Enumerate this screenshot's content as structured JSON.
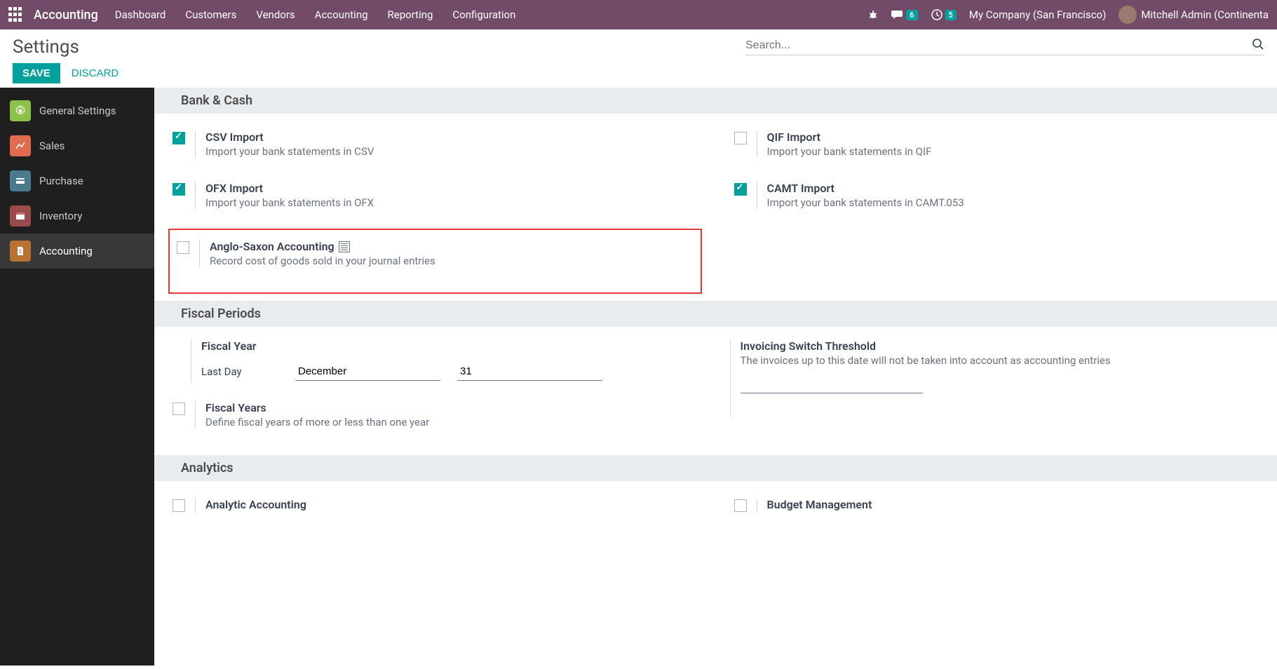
{
  "topnav": {
    "brand": "Accounting",
    "menu": [
      "Dashboard",
      "Customers",
      "Vendors",
      "Accounting",
      "Reporting",
      "Configuration"
    ],
    "chat_badge": "6",
    "clock_badge": "5",
    "company": "My Company (San Francisco)",
    "user": "Mitchell Admin (Continenta"
  },
  "page": {
    "title": "Settings",
    "save": "SAVE",
    "discard": "DISCARD",
    "search_placeholder": "Search..."
  },
  "sidebar": {
    "items": [
      {
        "label": "General Settings"
      },
      {
        "label": "Sales"
      },
      {
        "label": "Purchase"
      },
      {
        "label": "Inventory"
      },
      {
        "label": "Accounting"
      }
    ]
  },
  "sections": {
    "bank_cash": {
      "title": "Bank & Cash",
      "csv": {
        "title": "CSV Import",
        "desc": "Import your bank statements in CSV"
      },
      "qif": {
        "title": "QIF Import",
        "desc": "Import your bank statements in QIF"
      },
      "ofx": {
        "title": "OFX Import",
        "desc": "Import your bank statements in OFX"
      },
      "camt": {
        "title": "CAMT Import",
        "desc": "Import your bank statements in CAMT.053"
      },
      "anglo": {
        "title": "Anglo-Saxon Accounting",
        "desc": "Record cost of goods sold in your journal entries"
      }
    },
    "fiscal": {
      "title": "Fiscal Periods",
      "fy_label": "Fiscal Year",
      "last_day": "Last Day",
      "month": "December",
      "day": "31",
      "fy_opt": {
        "title": "Fiscal Years",
        "desc": "Define fiscal years of more or less than one year"
      },
      "threshold": {
        "title": "Invoicing Switch Threshold",
        "desc": "The invoices up to this date will not be taken into account as accounting entries"
      }
    },
    "analytics": {
      "title": "Analytics",
      "analytic": {
        "title": "Analytic Accounting"
      },
      "budget": {
        "title": "Budget Management"
      }
    }
  }
}
